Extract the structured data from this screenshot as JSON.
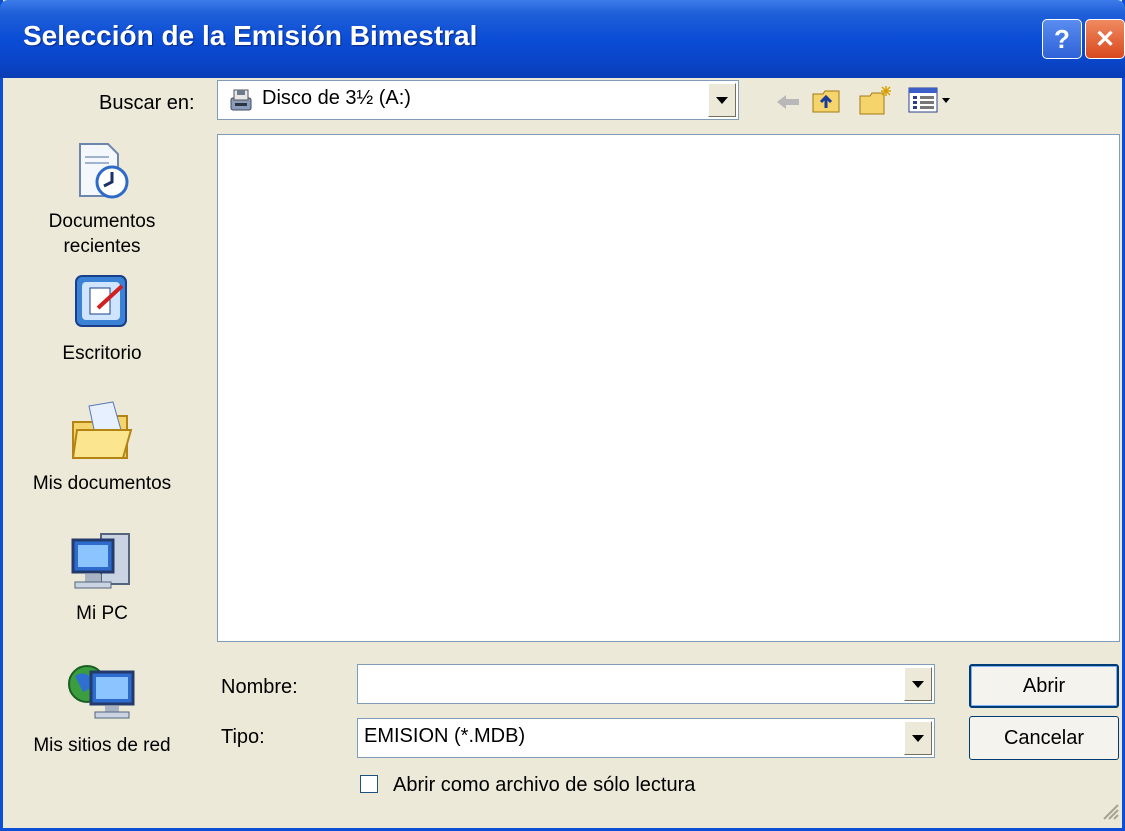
{
  "window": {
    "title": "Selección de la Emisión Bimestral"
  },
  "titlebar": {
    "help_label": "?",
    "close_label": "✕"
  },
  "look_in": {
    "label": "Buscar en:",
    "value": "Disco de 3½ (A:)"
  },
  "places": [
    {
      "label_lines": [
        "Documentos",
        "recientes"
      ],
      "icon": "recent-documents-icon"
    },
    {
      "label_lines": [
        "Escritorio"
      ],
      "icon": "desktop-icon"
    },
    {
      "label_lines": [
        "Mis documentos"
      ],
      "icon": "my-documents-icon"
    },
    {
      "label_lines": [
        "Mi PC"
      ],
      "icon": "my-computer-icon"
    },
    {
      "label_lines": [
        "Mis sitios de red"
      ],
      "icon": "network-places-icon"
    }
  ],
  "filename": {
    "label": "Nombre:",
    "value": ""
  },
  "filetype": {
    "label": "Tipo:",
    "value": "EMISION (*.MDB)"
  },
  "readonly": {
    "label": "Abrir como archivo de sólo lectura",
    "checked": false
  },
  "buttons": {
    "open": "Abrir",
    "cancel": "Cancelar"
  },
  "colors": {
    "titlebar": "#0a4fd6",
    "dialog_bg": "#ece9d8",
    "border": "#7f9db9"
  }
}
